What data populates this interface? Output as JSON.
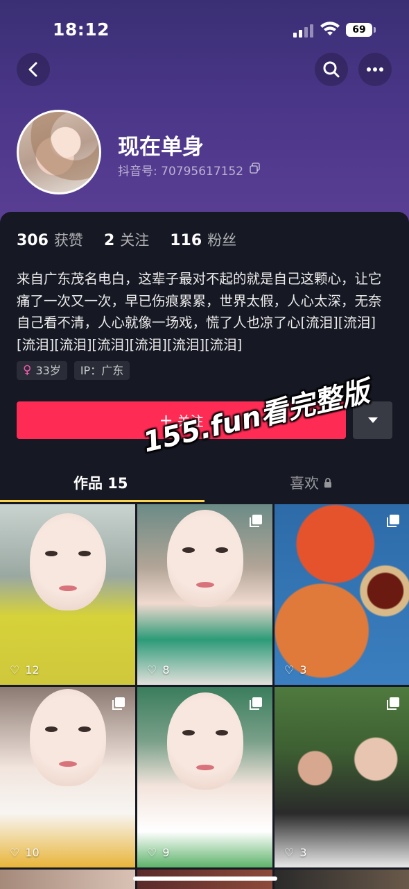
{
  "status_bar": {
    "time": "18:12",
    "battery": "69"
  },
  "profile": {
    "nickname": "现在单身",
    "douyin_id": "抖音号: 70795617152"
  },
  "stats": [
    {
      "value": "306",
      "label": "获赞"
    },
    {
      "value": "2",
      "label": "关注"
    },
    {
      "value": "116",
      "label": "粉丝"
    }
  ],
  "bio": "来自广东茂名电白，这辈子最对不起的就是自己这颗心，让它痛了一次又一次，早已伤痕累累，世界太假，人心太深，无奈自己看不清，人心就像一场戏，慌了人也凉了心[流泪][流泪][流泪][流泪][流泪][流泪][流泪][流泪]",
  "tags": {
    "age": "33岁",
    "ip": "IP：广东"
  },
  "actions": {
    "follow_label": "关注"
  },
  "watermark": "155.fun看完整版",
  "tabs": {
    "works": "作品 15",
    "likes": "喜欢"
  },
  "videos": [
    {
      "likes": "12",
      "multi": false
    },
    {
      "likes": "8",
      "multi": true
    },
    {
      "likes": "3",
      "multi": true
    },
    {
      "likes": "10",
      "multi": true
    },
    {
      "likes": "9",
      "multi": true
    },
    {
      "likes": "3",
      "multi": true
    }
  ],
  "colors": {
    "accent": "#fe2c55",
    "tab_indicator": "#fcd34d",
    "background": "#161823"
  }
}
